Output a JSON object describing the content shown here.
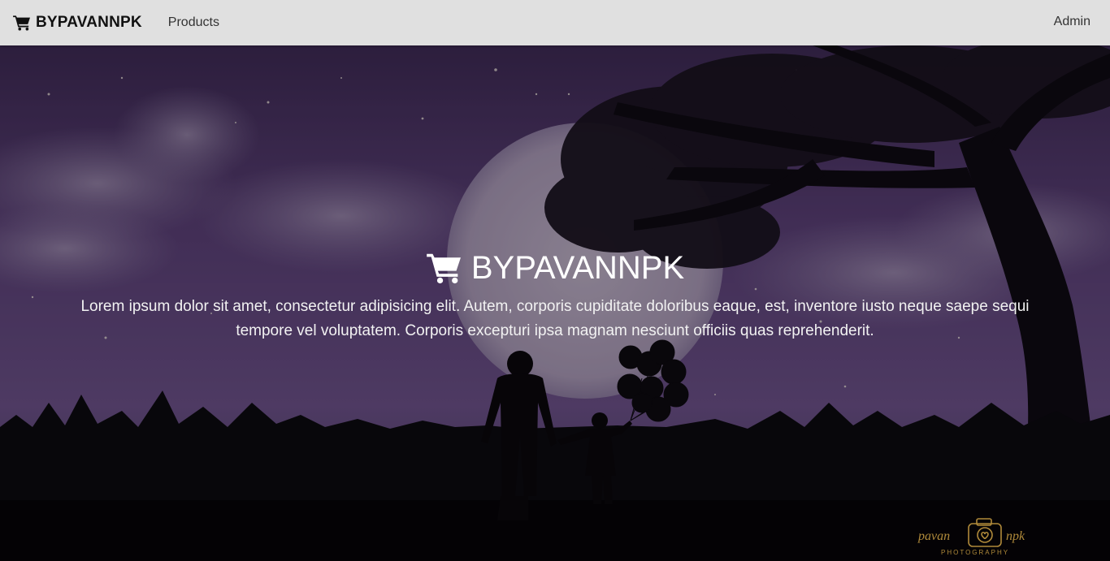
{
  "navbar": {
    "brand": "BYPAVANNPK",
    "brand_icon": "shopping-cart-icon",
    "links": [
      {
        "label": "Products"
      }
    ],
    "admin_label": "Admin"
  },
  "hero": {
    "title": "BYPAVANNPK",
    "title_icon": "shopping-cart-icon",
    "description": "Lorem ipsum dolor sit amet, consectetur adipisicing elit. Autem, corporis cupiditate doloribus eaque, est, inventore iusto neque saepe sequi tempore vel voluptatem. Corporis excepturi ipsa magnam nesciunt officiis quas reprehenderit.",
    "background_image": "night-sky-silhouette-father-child-balloons-tree",
    "watermark": {
      "line1": "pavan",
      "line2": "npk",
      "subtitle": "PHOTOGRAPHY"
    }
  },
  "colors": {
    "navbar_bg": "#e0e0e0",
    "sky_purple": "#6a4a8e",
    "text_white": "#ffffff",
    "watermark_gold": "#b08a3a"
  }
}
